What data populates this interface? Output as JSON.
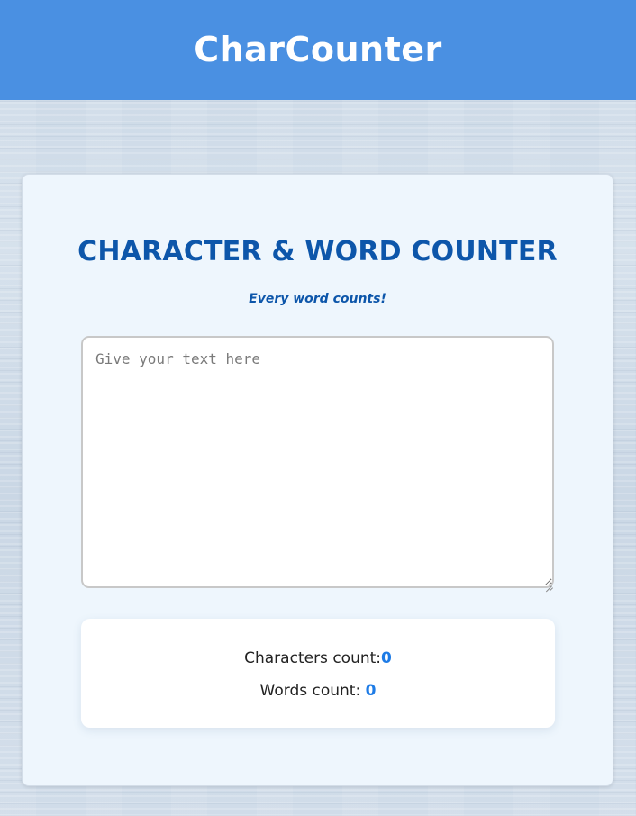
{
  "header": {
    "app_title": "CharCounter"
  },
  "card": {
    "heading": "CHARACTER & WORD COUNTER",
    "tagline": "Every word counts!",
    "textarea": {
      "placeholder": "Give your text here",
      "value": ""
    },
    "stats": {
      "characters_label": "Characters count:",
      "characters_value": "0",
      "words_label": "Words count: ",
      "words_value": "0"
    }
  },
  "colors": {
    "header_bg": "#4a90e2",
    "heading_text": "#0d56aa",
    "count_value": "#1d7be6",
    "card_bg": "#eef6fd"
  }
}
